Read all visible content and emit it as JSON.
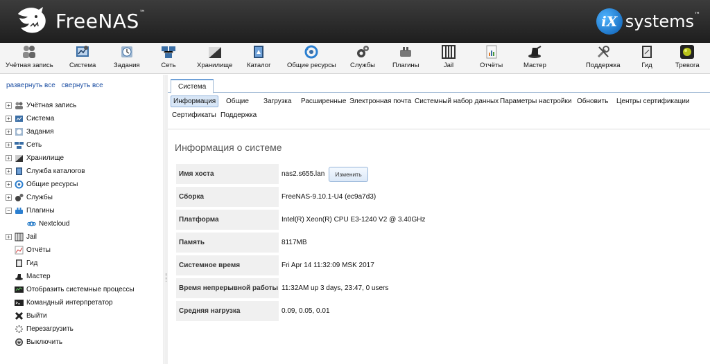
{
  "header": {
    "brand": "FreeNAS",
    "brand_tm": "™",
    "vendor": "systems",
    "vendor_badge": "iX",
    "vendor_tm": "™"
  },
  "toolbar": [
    {
      "label": "Учётная запись",
      "icon": "accounts-icon"
    },
    {
      "label": "Система",
      "icon": "system-icon"
    },
    {
      "label": "Задания",
      "icon": "tasks-icon"
    },
    {
      "label": "Сеть",
      "icon": "network-icon"
    },
    {
      "label": "Хранилище",
      "icon": "storage-icon"
    },
    {
      "label": "Каталог",
      "icon": "directory-icon"
    },
    {
      "label": "Общие ресурсы",
      "icon": "sharing-icon"
    },
    {
      "label": "Службы",
      "icon": "services-icon"
    },
    {
      "label": "Плагины",
      "icon": "plugins-icon"
    },
    {
      "label": "Jail",
      "icon": "jail-icon"
    },
    {
      "label": "Отчёты",
      "icon": "reports-icon"
    },
    {
      "label": "Мастер",
      "icon": "wizard-icon"
    },
    {
      "label": "Поддержка",
      "icon": "support-icon"
    },
    {
      "label": "Гид",
      "icon": "guide-icon"
    },
    {
      "label": "Тревога",
      "icon": "alert-icon"
    }
  ],
  "leftnav": {
    "expand_all": "развернуть все",
    "collapse_all": "свернуть все",
    "tree": [
      {
        "label": "Учётная запись",
        "expander": "+"
      },
      {
        "label": "Система",
        "expander": "+"
      },
      {
        "label": "Задания",
        "expander": "+"
      },
      {
        "label": "Сеть",
        "expander": "+"
      },
      {
        "label": "Хранилище",
        "expander": "+"
      },
      {
        "label": "Служба каталогов",
        "expander": "+"
      },
      {
        "label": "Общие ресурсы",
        "expander": "+"
      },
      {
        "label": "Службы",
        "expander": "+"
      },
      {
        "label": "Плагины",
        "expander": "−"
      },
      {
        "label": "Nextcloud",
        "expander": ""
      },
      {
        "label": "Jail",
        "expander": "+"
      },
      {
        "label": "Отчёты",
        "expander": ""
      },
      {
        "label": "Гид",
        "expander": ""
      },
      {
        "label": "Мастер",
        "expander": ""
      },
      {
        "label": "Отобразить системные процессы",
        "expander": ""
      },
      {
        "label": "Командный интерпретатор",
        "expander": ""
      },
      {
        "label": "Выйти",
        "expander": ""
      },
      {
        "label": "Перезагрузить",
        "expander": ""
      },
      {
        "label": "Выключить",
        "expander": ""
      }
    ]
  },
  "main": {
    "tab": "Система",
    "subnav": [
      "Информация",
      "Общие",
      "Загрузка",
      "Расширенные",
      "Электронная почта",
      "Системный набор данных",
      "Параметры настройки",
      "Обновить",
      "Центры сертификации",
      "Сертификаты",
      "Поддержка"
    ],
    "section_title": "Информация о системе",
    "change_button": "Изменить",
    "info": [
      {
        "label": "Имя хоста",
        "value": "nas2.s655.lan"
      },
      {
        "label": "Сборка",
        "value": "FreeNAS-9.10.1-U4 (ec9a7d3)"
      },
      {
        "label": "Платформа",
        "value": "Intel(R) Xeon(R) CPU E3-1240 V2 @ 3.40GHz"
      },
      {
        "label": "Память",
        "value": "8117MB"
      },
      {
        "label": "Системное время",
        "value": "Fri Apr 14 11:32:09 MSK 2017"
      },
      {
        "label": "Время непрерывной работы",
        "value": "11:32AM up 3 days, 23:47, 0 users"
      },
      {
        "label": "Средняя нагрузка",
        "value": "0.09, 0.05, 0.01"
      }
    ]
  }
}
